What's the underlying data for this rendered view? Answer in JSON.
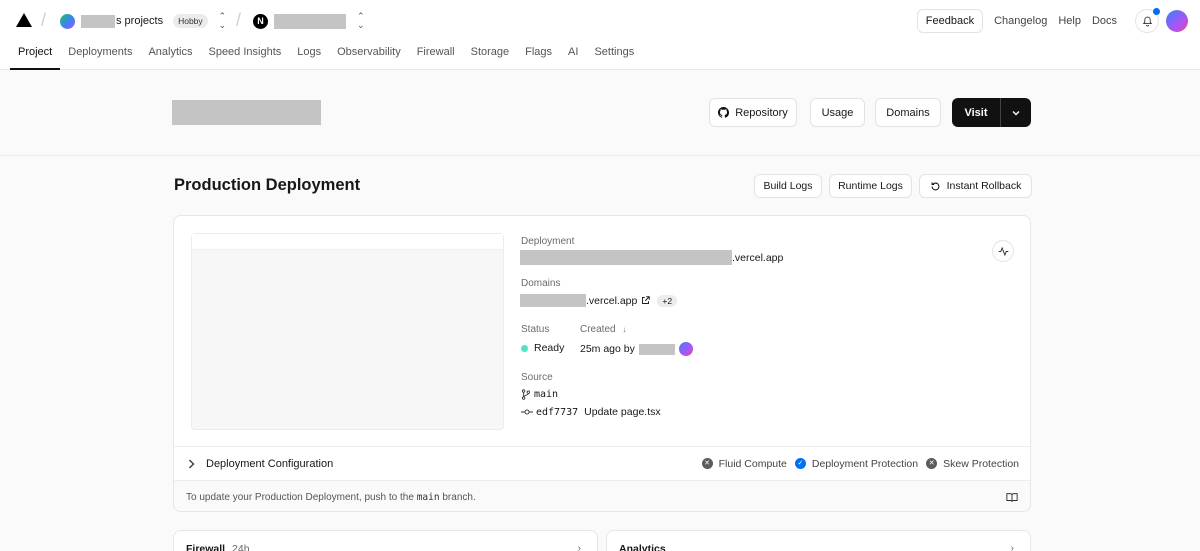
{
  "topbar": {
    "team_name": "s projects",
    "plan_badge": "Hobby",
    "project_logo_letter": "N",
    "feedback_label": "Feedback",
    "links": [
      "Changelog",
      "Help",
      "Docs"
    ]
  },
  "tabs": [
    "Project",
    "Deployments",
    "Analytics",
    "Speed Insights",
    "Logs",
    "Observability",
    "Firewall",
    "Storage",
    "Flags",
    "AI",
    "Settings"
  ],
  "active_tab": "Project",
  "header": {
    "repository_label": "Repository",
    "usage_label": "Usage",
    "domains_label": "Domains",
    "visit_label": "Visit"
  },
  "production": {
    "title": "Production Deployment",
    "build_logs_label": "Build Logs",
    "runtime_logs_label": "Runtime Logs",
    "instant_rollback_label": "Instant Rollback",
    "deployment_label": "Deployment",
    "deployment_url_suffix": ".vercel.app",
    "domains_label": "Domains",
    "domain_suffix": ".vercel.app",
    "domains_extra_count": "+2",
    "status_label": "Status",
    "status_value": "Ready",
    "created_label": "Created",
    "created_value": "25m ago by",
    "source_label": "Source",
    "branch": "main",
    "commit_hash": "edf7737",
    "commit_message": "Update page.tsx",
    "config_label": "Deployment Configuration",
    "features": [
      {
        "label": "Fluid Compute",
        "enabled": false
      },
      {
        "label": "Deployment Protection",
        "enabled": true
      },
      {
        "label": "Skew Protection",
        "enabled": false
      }
    ],
    "footer_text_before": "To update your Production Deployment, push to the",
    "footer_branch": "main",
    "footer_text_after": "branch."
  },
  "cards": {
    "firewall_title": "Firewall",
    "firewall_period": "24h",
    "analytics_title": "Analytics"
  },
  "colors": {
    "ready": "#50e3c2",
    "enabled_feature": "#0070f3",
    "disabled_feature": "#5c5c5c",
    "notification_dot": "#0070f3"
  }
}
